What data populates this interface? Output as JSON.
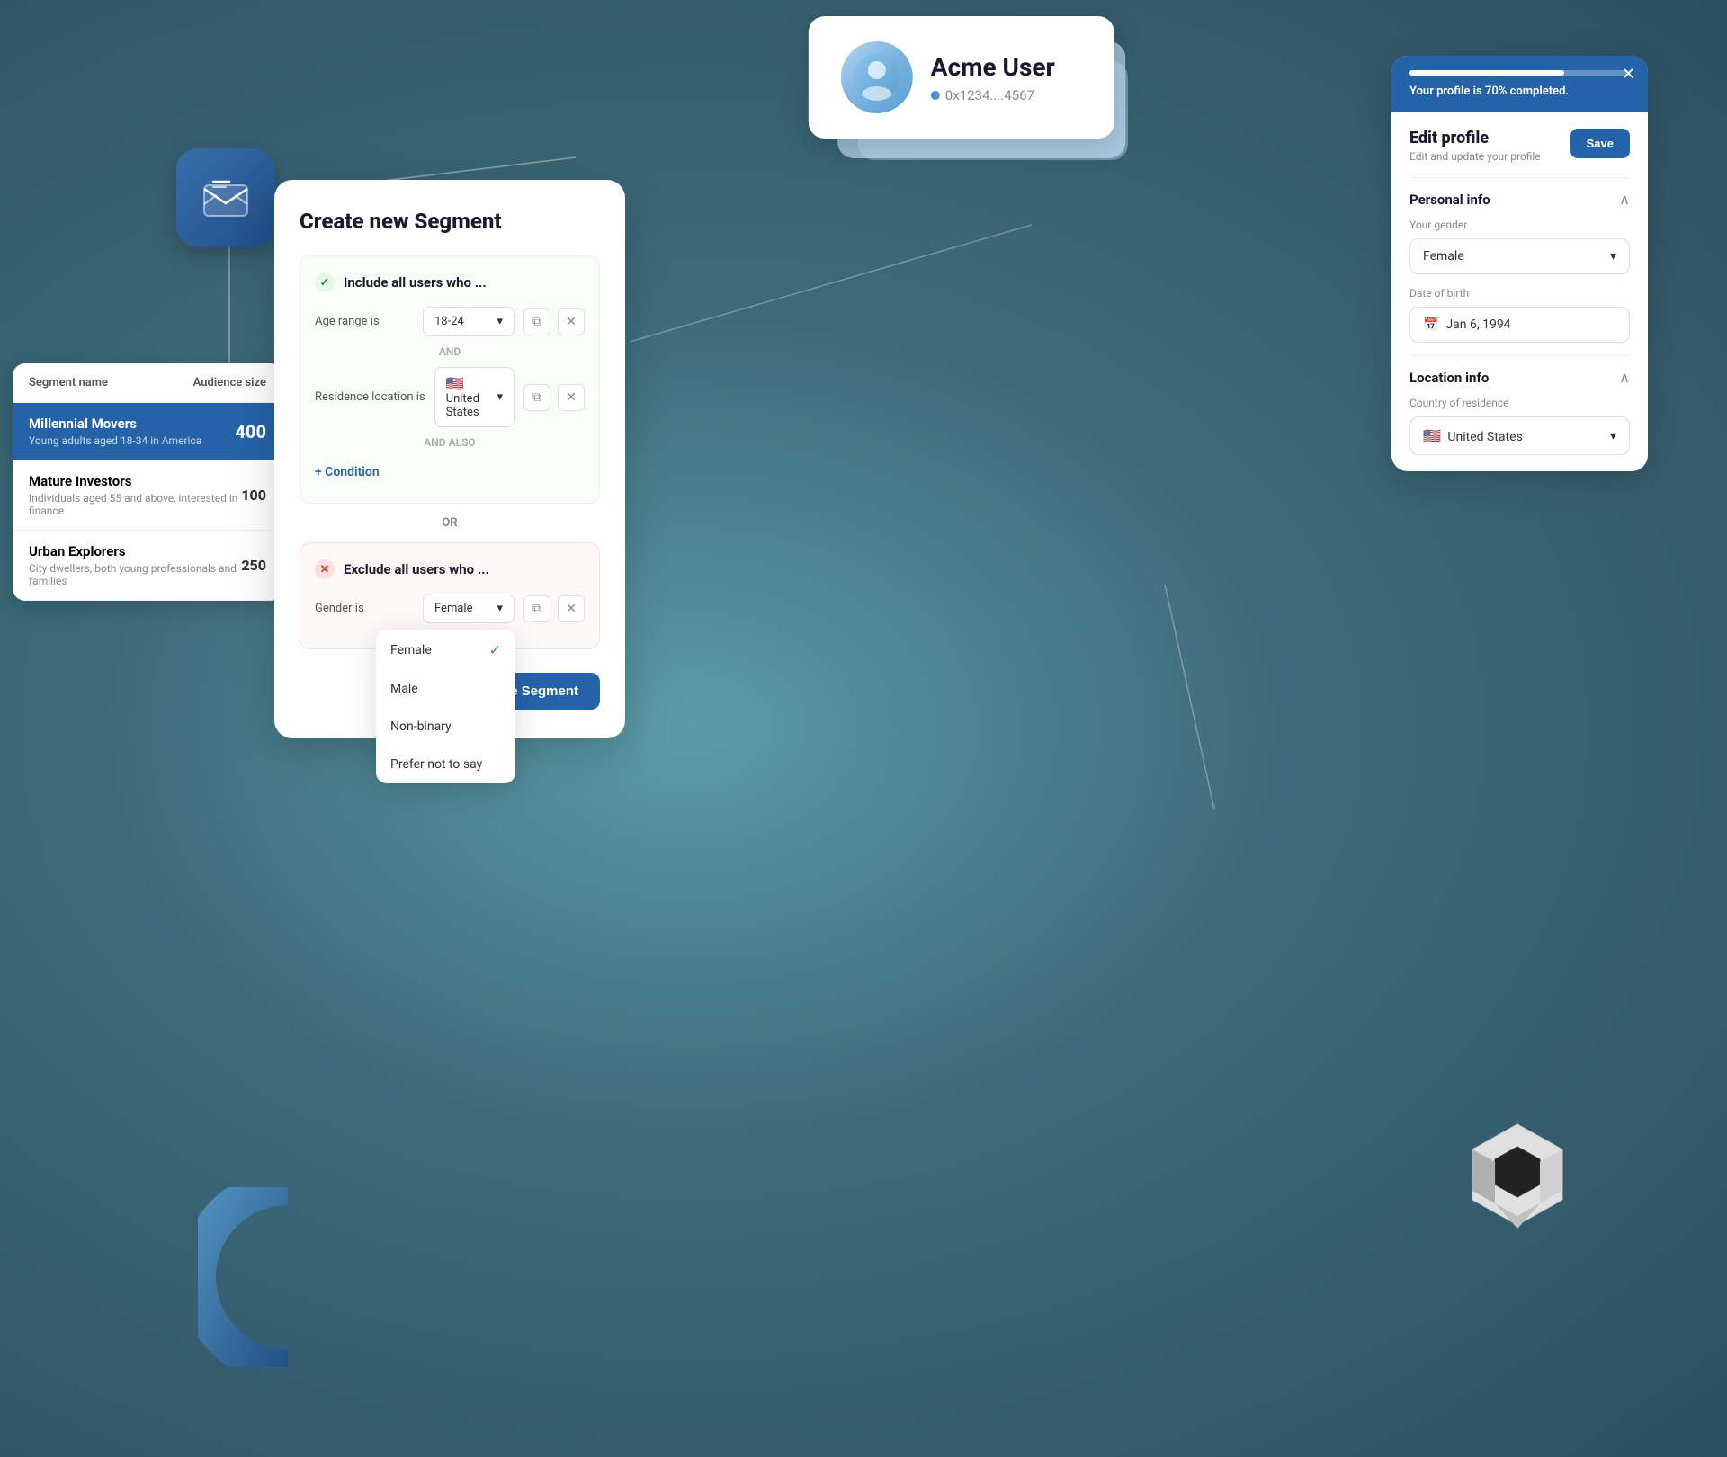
{
  "background": {
    "color": "#4a7a8a"
  },
  "profile_card": {
    "name": "Acme User",
    "id": "0x1234....4567",
    "id_prefix": "0x1234....4567"
  },
  "segment_list": {
    "header": {
      "segment_name_label": "Segment name",
      "audience_size_label": "Audience size"
    },
    "items": [
      {
        "name": "Millennial Movers",
        "desc": "Young adults aged 18-34 in America",
        "count": "400",
        "highlighted": true
      },
      {
        "name": "Mature Investors",
        "desc": "Individuals aged 55 and above, interested in finance",
        "count": "100",
        "highlighted": false
      },
      {
        "name": "Urban Explorers",
        "desc": "City dwellers, both young professionals and families",
        "count": "250",
        "highlighted": false
      }
    ]
  },
  "create_segment_modal": {
    "title": "Create new Segment",
    "include_group": {
      "label": "Include all users who ...",
      "conditions": [
        {
          "label": "Age range is",
          "value": "18-24"
        },
        {
          "separator": "AND"
        },
        {
          "label": "Residence location is",
          "value": "United States",
          "has_flag": true
        }
      ],
      "and_also": "AND ALSO",
      "add_condition": "+ Condition"
    },
    "or_separator": "OR",
    "exclude_group": {
      "label": "Exclude all users who ...",
      "conditions": [
        {
          "label": "Gender is",
          "value": "Female"
        }
      ]
    },
    "save_button": "Save Segment"
  },
  "gender_dropdown": {
    "options": [
      {
        "label": "Female",
        "selected": true
      },
      {
        "label": "Male",
        "selected": false
      },
      {
        "label": "Non-binary",
        "selected": false
      },
      {
        "label": "Prefer not to say",
        "selected": false
      }
    ]
  },
  "edit_profile_panel": {
    "progress_text": "Your profile is 70% completed.",
    "progress_pct": 70,
    "title": "Edit profile",
    "subtitle": "Edit and update your profile",
    "save_button": "Save",
    "personal_info_section": {
      "title": "Personal info",
      "gender_label": "Your gender",
      "gender_value": "Female",
      "dob_label": "Date of birth",
      "dob_value": "Jan 6, 1994"
    },
    "location_info_section": {
      "title": "Location info",
      "country_label": "Country of residence",
      "country_value": "United States"
    }
  },
  "mail_icon": {
    "alt": "mail"
  }
}
